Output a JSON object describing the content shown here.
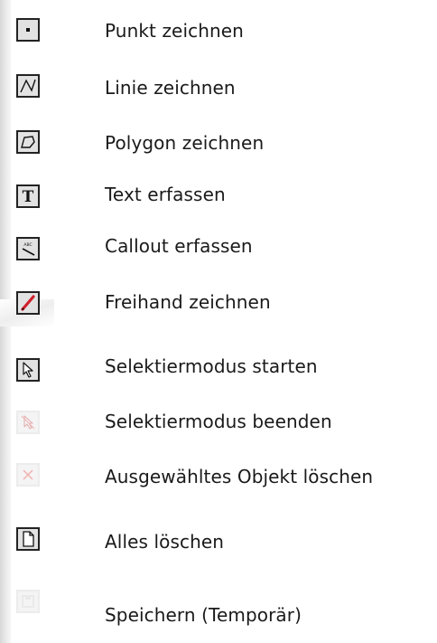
{
  "toolbar": {
    "items": [
      {
        "label": "Punkt zeichnen",
        "icon": "point-icon",
        "enabled": true
      },
      {
        "label": "Linie zeichnen",
        "icon": "line-icon",
        "enabled": true
      },
      {
        "label": "Polygon zeichnen",
        "icon": "polygon-icon",
        "enabled": true
      },
      {
        "label": "Text erfassen",
        "icon": "text-icon",
        "enabled": true
      },
      {
        "label": "Callout erfassen",
        "icon": "callout-icon",
        "enabled": true
      },
      {
        "label": "Freihand zeichnen",
        "icon": "freehand-pencil-icon",
        "enabled": true
      },
      {
        "label": "Selektiermodus starten",
        "icon": "select-arrow-icon",
        "enabled": true
      },
      {
        "label": "Selektiermodus beenden",
        "icon": "select-end-icon",
        "enabled": false
      },
      {
        "label": "Ausgewähltes Objekt löschen",
        "icon": "delete-x-icon",
        "enabled": false
      },
      {
        "label": "Alles löschen",
        "icon": "new-document-icon",
        "enabled": true
      },
      {
        "label": "Speichern (Temporär)",
        "icon": "save-icon",
        "enabled": false
      }
    ]
  },
  "colors": {
    "text": "#1a1a1a",
    "icon_border": "#222222",
    "icon_background": "#e2e2e2",
    "pencil_red": "#d0202a",
    "disabled_red": "#f0b0b0"
  }
}
